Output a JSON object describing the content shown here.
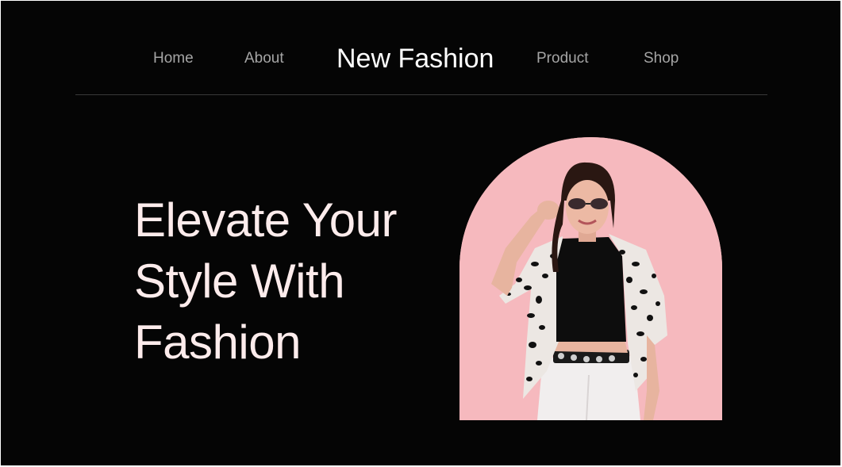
{
  "nav": {
    "home": "Home",
    "about": "About",
    "brand": "New Fashion",
    "product": "Product",
    "shop": "Shop"
  },
  "hero": {
    "heading_lines": [
      "Elevate Your",
      "Style With",
      "Fashion"
    ],
    "image": {
      "subject": "model-photo",
      "background_color": "#f6b9be"
    }
  },
  "colors": {
    "page_background": "#050505",
    "nav_link": "#a5a5a5",
    "brand": "#ffffff",
    "heading": "#fdecec",
    "divider": "#3a3a3a",
    "accent_pink": "#f6b9be"
  }
}
